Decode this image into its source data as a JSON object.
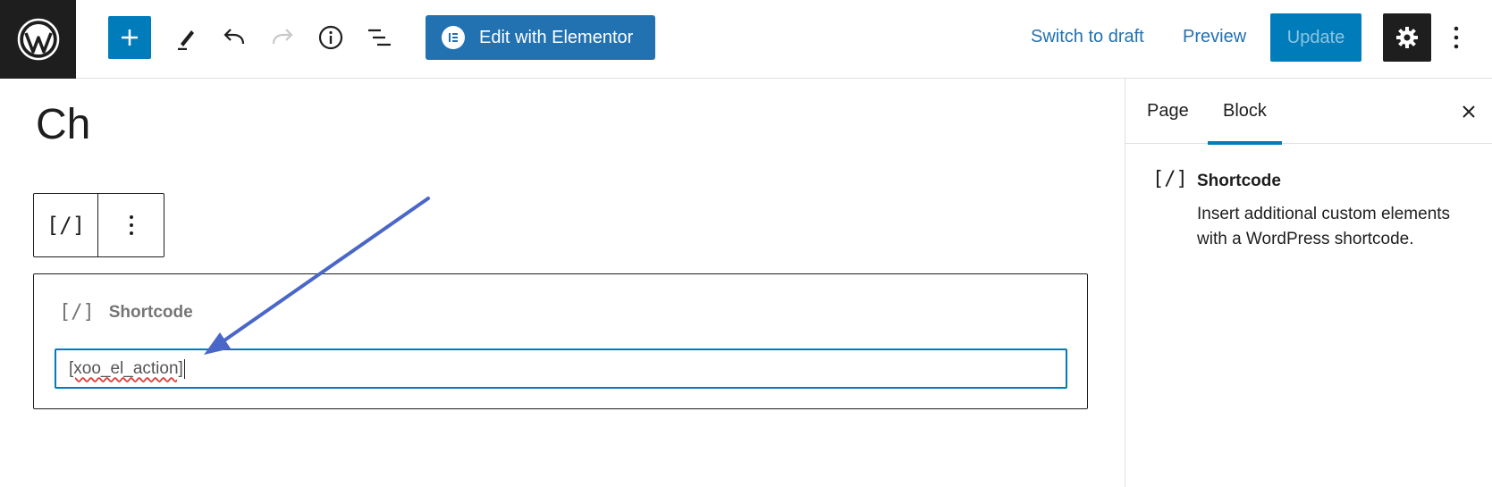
{
  "topbar": {
    "elementor_label": "Edit with Elementor",
    "switch_to_draft": "Switch to draft",
    "preview": "Preview",
    "update": "Update"
  },
  "canvas": {
    "ghost_title": "Ch",
    "block_toolbar": {
      "type_glyph": "[/]"
    },
    "shortcode_block": {
      "glyph": "[/]",
      "label": "Shortcode",
      "input_value": "[xoo_el_action]"
    }
  },
  "sidebar": {
    "tabs": [
      {
        "label": "Page",
        "active": false
      },
      {
        "label": "Block",
        "active": true
      }
    ],
    "block_card": {
      "glyph": "[/]",
      "title": "Shortcode",
      "description": "Insert additional custom elements with a WordPress shortcode."
    }
  },
  "colors": {
    "accent": "#007cba",
    "elementor_button": "#2271b1",
    "dark": "#1e1e1e",
    "annotation_arrow": "#4a67c7"
  },
  "icons": [
    "wordpress-logo-icon",
    "plus-icon",
    "pencil-icon",
    "undo-icon",
    "redo-icon",
    "info-icon",
    "list-view-icon",
    "elementor-icon",
    "gear-icon",
    "more-vertical-icon",
    "close-icon"
  ]
}
